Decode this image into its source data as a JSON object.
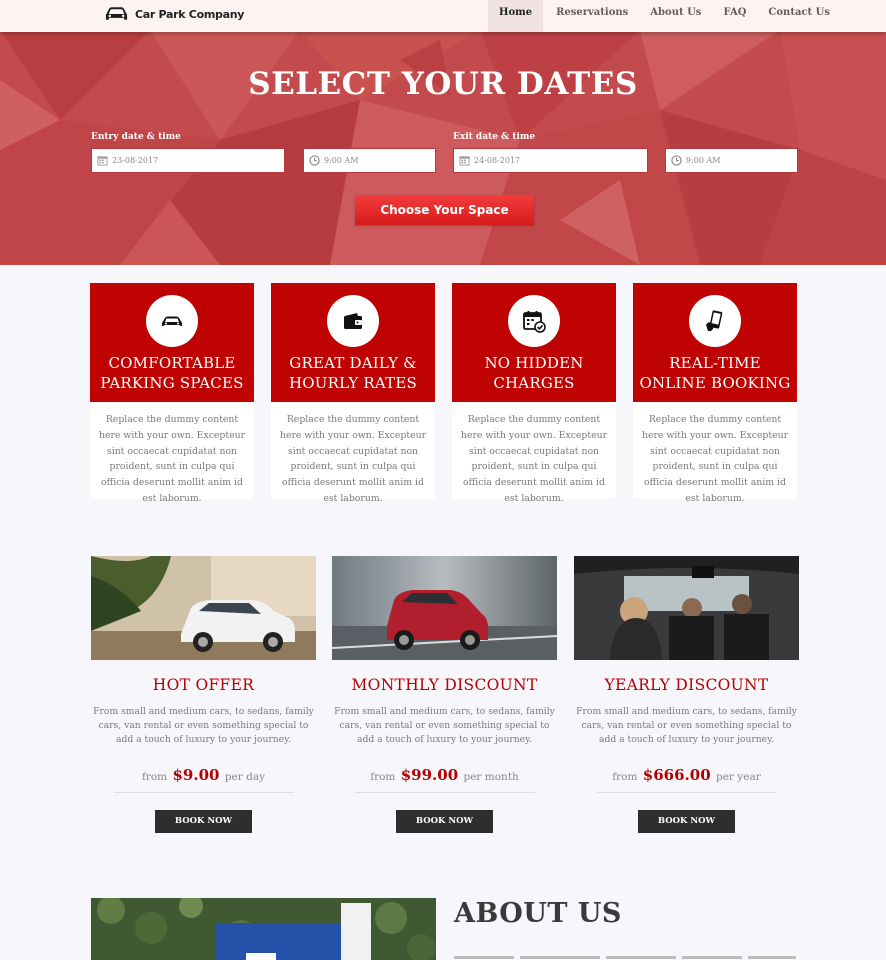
{
  "brand": {
    "name": "Car Park Company",
    "logo": "car-icon"
  },
  "nav": [
    {
      "label": "Home",
      "active": true
    },
    {
      "label": "Reservations"
    },
    {
      "label": "About Us"
    },
    {
      "label": "FAQ"
    },
    {
      "label": "Contact Us"
    }
  ],
  "hero": {
    "title": "SELECT YOUR DATES",
    "entry_label": "Entry date & time",
    "exit_label": "Exit date & time",
    "entry_date": "23-08-2017",
    "entry_time": "9:00 AM",
    "exit_date": "24-08-2017",
    "exit_time": "9:00 AM",
    "cta": "Choose Your Space",
    "icons": {
      "date": "calendar-icon",
      "time": "clock-icon"
    }
  },
  "features": [
    {
      "icon": "car-icon",
      "title_line1": "COMFORTABLE",
      "title_line2": "PARKING SPACES",
      "text": "Replace the dummy content here with your own. Excepteur sint occaecat cupidatat non proident, sunt in culpa qui officia deserunt mollit anim id est laborum."
    },
    {
      "icon": "wallet-icon",
      "title_line1": "GREAT DAILY &",
      "title_line2": "HOURLY RATES",
      "text": "Replace the dummy content here with your own. Excepteur sint occaecat cupidatat non proident, sunt in culpa qui officia deserunt mollit anim id est laborum."
    },
    {
      "icon": "calendar-check-icon",
      "title_line1": "NO HIDDEN",
      "title_line2": "CHARGES",
      "text": "Replace the dummy content here with your own. Excepteur sint occaecat cupidatat non proident, sunt in culpa qui officia deserunt mollit anim id est laborum."
    },
    {
      "icon": "phone-booking-icon",
      "title_line1": "REAL-TIME",
      "title_line2": "ONLINE BOOKING",
      "text": "Replace the dummy content here with your own. Excepteur sint occaecat cupidatat non proident, sunt in culpa qui officia deserunt mollit anim id est laborum."
    }
  ],
  "offers": [
    {
      "title": "HOT OFFER",
      "text": "From small and medium cars, to sedans, family cars, van rental or even something special to add a touch of luxury to your journey.",
      "from": "from",
      "price": "$9.00",
      "period": "per day",
      "button": "BOOK NOW"
    },
    {
      "title": "MONTHLY DISCOUNT",
      "text": "From small and medium cars, to sedans, family cars, van rental or even something special to add a touch of luxury to your journey.",
      "from": "from",
      "price": "$99.00",
      "period": "per month",
      "button": "BOOK NOW"
    },
    {
      "title": "YEARLY DISCOUNT",
      "text": "From small and medium cars, to sedans, family cars, van rental or even something special to add a touch of luxury to your journey.",
      "from": "from",
      "price": "$666.00",
      "period": "per year",
      "button": "BOOK NOW"
    }
  ],
  "about": {
    "title": "ABOUT US"
  },
  "colors": {
    "accent": "#bf0202",
    "hero_red": "#c04649",
    "button_dark": "#2e2e2e"
  }
}
